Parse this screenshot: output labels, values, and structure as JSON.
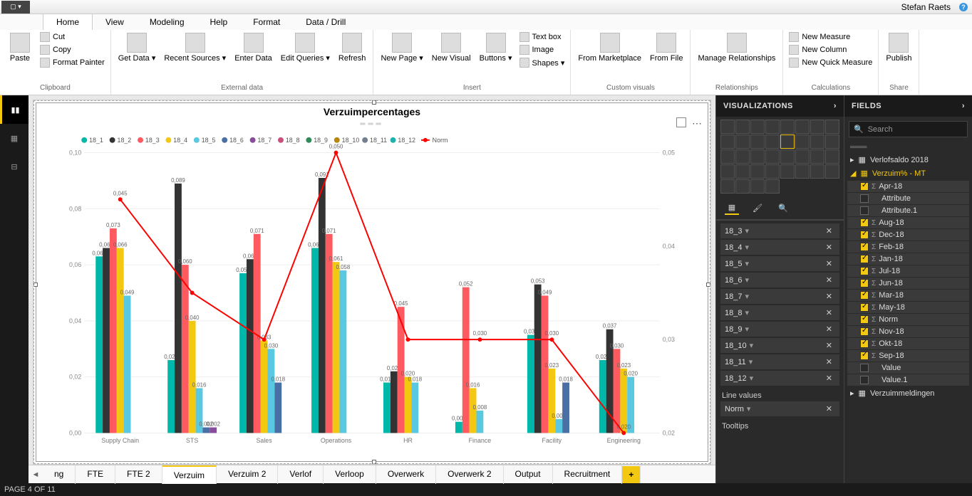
{
  "user": "Stefan Raets",
  "ribbon_tabs": [
    "Home",
    "View",
    "Modeling",
    "Help",
    "Format",
    "Data / Drill"
  ],
  "active_ribbon": 0,
  "clipboard": {
    "cut": "Cut",
    "copy": "Copy",
    "fp": "Format Painter",
    "paste": "Paste",
    "group": "Clipboard"
  },
  "extdata": {
    "get": "Get\nData ▾",
    "recent": "Recent\nSources ▾",
    "enter": "Enter\nData",
    "edit": "Edit\nQueries ▾",
    "refresh": "Refresh",
    "group": "External data"
  },
  "insert": {
    "newpage": "New\nPage ▾",
    "newvis": "New\nVisual",
    "buttons": "Buttons\n▾",
    "textbox": "Text box",
    "image": "Image",
    "shapes": "Shapes ▾",
    "group": "Insert"
  },
  "custom": {
    "market": "From\nMarketplace",
    "file": "From\nFile",
    "group": "Custom visuals"
  },
  "rel": {
    "manage": "Manage\nRelationships",
    "group": "Relationships"
  },
  "calc": {
    "measure": "New Measure",
    "column": "New Column",
    "quick": "New Quick Measure",
    "group": "Calculations"
  },
  "share": {
    "publish": "Publish",
    "group": "Share"
  },
  "pages": [
    "ng",
    "FTE",
    "FTE 2",
    "Verzuim",
    "Verzuim 2",
    "Verlof",
    "Verloop",
    "Overwerk",
    "Overwerk 2",
    "Output",
    "Recruitment"
  ],
  "active_page": 3,
  "viz_hdr": "VISUALIZATIONS",
  "fields_hdr": "FIELDS",
  "search_ph": "Search",
  "wells": [
    "18_3",
    "18_4",
    "18_5",
    "18_6",
    "18_7",
    "18_8",
    "18_9",
    "18_10",
    "18_11",
    "18_12"
  ],
  "line_values_label": "Line values",
  "line_well": "Norm",
  "tooltips_label": "Tooltips",
  "tables": [
    {
      "name": "Verlofsaldo 2018",
      "expanded": false,
      "selected": false
    },
    {
      "name": "Verzuim% - MT",
      "expanded": true,
      "selected": true,
      "fields": [
        {
          "name": "Apr-18",
          "checked": true,
          "sigma": true
        },
        {
          "name": "Attribute",
          "checked": false,
          "sigma": false
        },
        {
          "name": "Attribute.1",
          "checked": false,
          "sigma": false
        },
        {
          "name": "Aug-18",
          "checked": true,
          "sigma": true
        },
        {
          "name": "Dec-18",
          "checked": true,
          "sigma": true
        },
        {
          "name": "Feb-18",
          "checked": true,
          "sigma": true
        },
        {
          "name": "Jan-18",
          "checked": true,
          "sigma": true
        },
        {
          "name": "Jul-18",
          "checked": true,
          "sigma": true
        },
        {
          "name": "Jun-18",
          "checked": true,
          "sigma": true
        },
        {
          "name": "Mar-18",
          "checked": true,
          "sigma": true
        },
        {
          "name": "May-18",
          "checked": true,
          "sigma": true
        },
        {
          "name": "Norm",
          "checked": true,
          "sigma": true
        },
        {
          "name": "Nov-18",
          "checked": true,
          "sigma": true
        },
        {
          "name": "Okt-18",
          "checked": true,
          "sigma": true
        },
        {
          "name": "Sep-18",
          "checked": true,
          "sigma": true
        },
        {
          "name": "Value",
          "checked": false,
          "sigma": false
        },
        {
          "name": "Value.1",
          "checked": false,
          "sigma": false
        }
      ]
    },
    {
      "name": "Verzuimmeldingen",
      "expanded": false,
      "selected": false
    }
  ],
  "status": "PAGE 4 OF 11",
  "chart_data": {
    "type": "bar+line",
    "title": "Verzuimpercentages",
    "y_left": {
      "min": 0,
      "max": 0.1,
      "ticks": [
        0.0,
        0.02,
        0.04,
        0.06,
        0.08,
        0.1
      ]
    },
    "y_right": {
      "min": 0.02,
      "max": 0.05,
      "ticks": [
        0.02,
        0.03,
        0.04,
        0.05
      ]
    },
    "categories": [
      "Supply Chain",
      "STS",
      "Sales",
      "Operations",
      "HR",
      "Finance",
      "Facility",
      "Engineering"
    ],
    "series": [
      {
        "name": "18_1",
        "color": "#00b8a9",
        "values": [
          0.063,
          0.026,
          0.057,
          0.066,
          0.018,
          0.004,
          0.035,
          0.026
        ]
      },
      {
        "name": "18_2",
        "color": "#333333",
        "values": [
          0.066,
          0.089,
          0.062,
          0.091,
          0.022,
          null,
          0.053,
          0.037
        ]
      },
      {
        "name": "18_3",
        "color": "#ff5a5f",
        "values": [
          0.073,
          0.06,
          0.071,
          0.071,
          0.045,
          0.052,
          0.049,
          0.03
        ]
      },
      {
        "name": "18_4",
        "color": "#f2c811",
        "values": [
          0.066,
          0.04,
          0.033,
          0.061,
          0.02,
          0.016,
          0.023,
          0.023
        ]
      },
      {
        "name": "18_5",
        "color": "#5ac8e0",
        "values": [
          0.049,
          0.016,
          0.03,
          0.058,
          0.018,
          0.008,
          0.005,
          0.02
        ]
      },
      {
        "name": "18_6",
        "color": "#4a6fa5",
        "values": [
          null,
          0.002,
          0.018,
          null,
          null,
          null,
          0.018,
          null
        ]
      },
      {
        "name": "18_7",
        "color": "#8a4a9e",
        "values": [
          null,
          0.002,
          null,
          null,
          null,
          null,
          null,
          null
        ]
      },
      {
        "name": "18_8",
        "color": "#c94f7c",
        "values": [
          null,
          null,
          null,
          null,
          null,
          null,
          null,
          null
        ]
      },
      {
        "name": "18_9",
        "color": "#2e8b57",
        "values": [
          null,
          null,
          null,
          null,
          null,
          null,
          null,
          null
        ]
      },
      {
        "name": "18_10",
        "color": "#b8860b",
        "values": [
          null,
          null,
          null,
          null,
          null,
          null,
          null,
          null
        ]
      },
      {
        "name": "18_11",
        "color": "#708090",
        "values": [
          null,
          null,
          null,
          null,
          null,
          null,
          null,
          null
        ]
      },
      {
        "name": "18_12",
        "color": "#20b2aa",
        "values": [
          null,
          null,
          null,
          null,
          null,
          null,
          null,
          null
        ]
      }
    ],
    "line": {
      "name": "Norm",
      "color": "#ff0000",
      "values": [
        0.045,
        0.035,
        0.03,
        0.05,
        0.03,
        0.03,
        0.03,
        0.02
      ]
    },
    "value_labels": {
      "Supply Chain": [
        "0,063",
        "0,066",
        "0,073",
        "0,066",
        "0,049"
      ],
      "STS": [
        "0,026",
        "0,089",
        "0,060",
        "0,040",
        "0,016",
        "0,002",
        "0,002"
      ],
      "Sales": [
        "0,057",
        "0,062",
        "0,071",
        "0,033",
        "0,030",
        "0,018"
      ],
      "Operations": [
        "0,066",
        "0,091",
        "0,071",
        "0,061",
        "0,058"
      ],
      "HR": [
        "0,018",
        "0,022",
        "0,045",
        "0,020",
        "0,018"
      ],
      "Finance": [
        "0,004",
        "0,052",
        "0,016",
        "0,008"
      ],
      "Facility": [
        "0,035",
        "0,053",
        "0,049",
        "0,023",
        "0,005",
        "0,018"
      ],
      "Engineering": [
        "0,026",
        "0,037",
        "0,030",
        "0,023",
        "0,020"
      ]
    },
    "line_point_labels": [
      "0,045",
      null,
      null,
      "0,050",
      null,
      "0,030",
      "0,030",
      "0,020"
    ]
  }
}
